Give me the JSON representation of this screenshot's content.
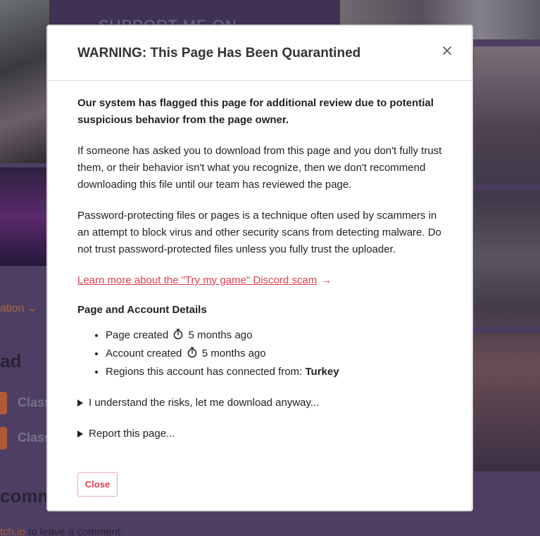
{
  "modal": {
    "title": "WARNING: This Page Has Been Quarantined",
    "intro": "Our system has flagged this page for additional review due to potential suspicious behavior from the page owner.",
    "paragraph1": "If someone has asked you to download from this page and you don't fully trust them, or their behavior isn't what you recognize, then we don't recommend downloading this file until our team has reviewed the page.",
    "paragraph2": "Password-protecting files or pages is a technique often used by scammers in an attempt to block virus and other security scans from detecting malware. Do not trust password-protected files unless you fully trust the uploader.",
    "learn_link": "Learn more about the \"Try my game\" Discord scam",
    "learn_arrow": "→",
    "details_title": "Page and Account Details",
    "details": {
      "page_created_label": "Page created",
      "page_created_value": "5 months ago",
      "account_created_label": "Account created",
      "account_created_value": "5 months ago",
      "regions_label": "Regions this account has connected from:",
      "regions_value": "Turkey"
    },
    "disclosure_download": "I understand the risks, let me download anyway...",
    "disclosure_report": "Report this page...",
    "close_button": "Close",
    "accent_color": "#e03e4f"
  },
  "background": {
    "support_text": "SUPPORT ME ON",
    "nav_link": "ation",
    "heading_partial": "ad",
    "class_item_1": "Class",
    "class_item_2": "Class",
    "comments_partial": "comm",
    "footer_link": "tch.io",
    "footer_text": "to leave a comment."
  }
}
